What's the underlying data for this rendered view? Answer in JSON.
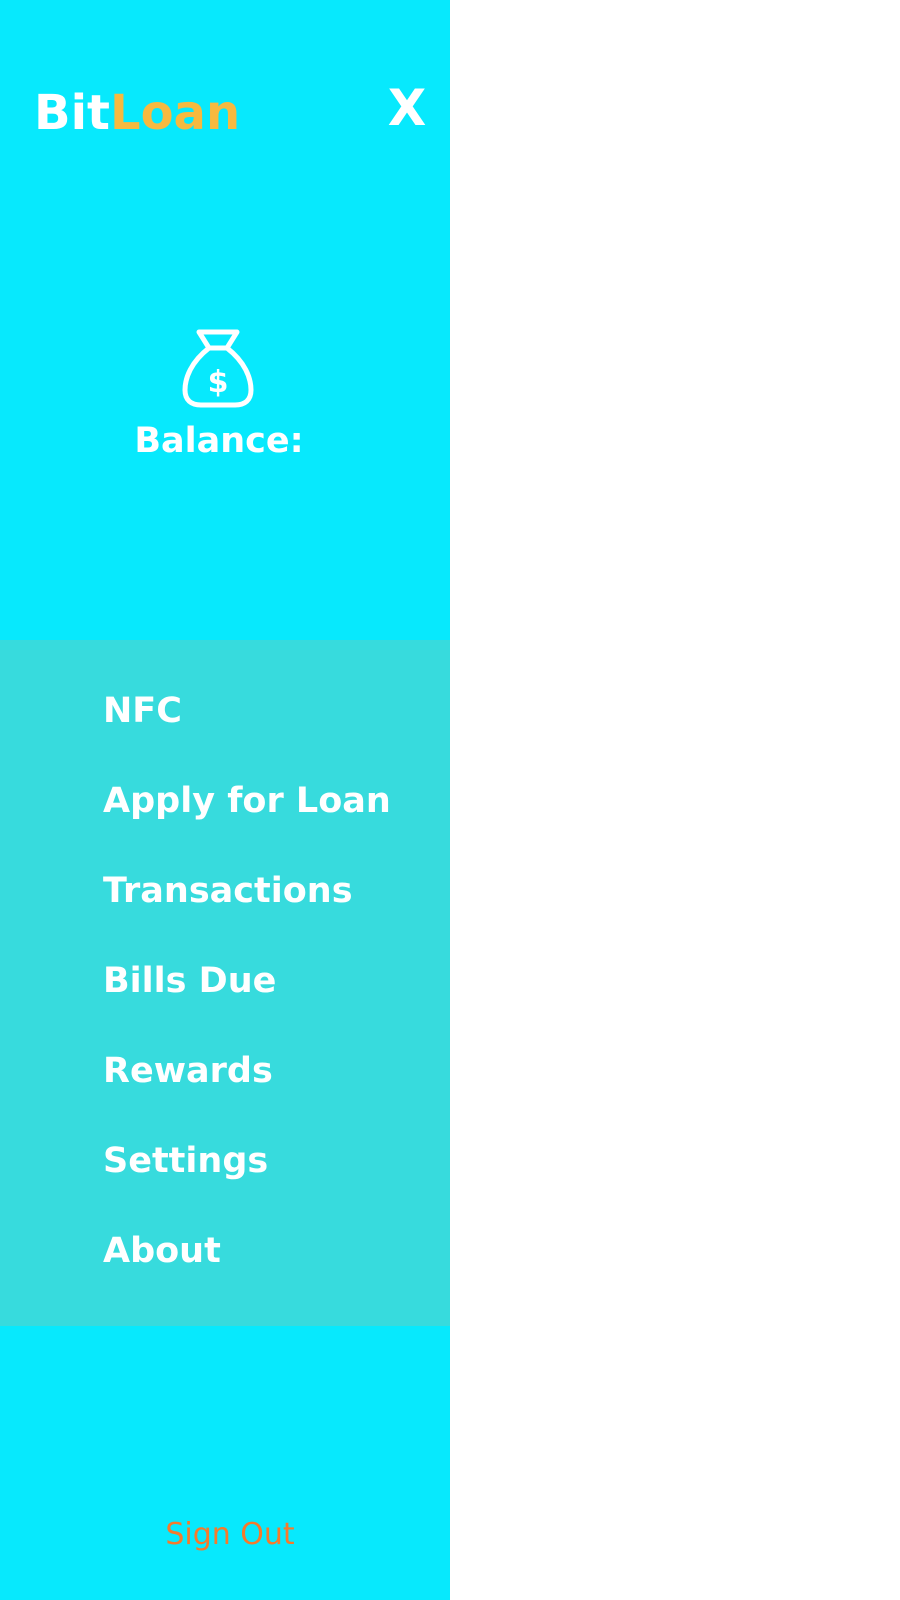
{
  "brand": {
    "part1": "Bit",
    "part2": "Loan",
    "color_part1": "#ffffff",
    "color_part2": "#f7b93f"
  },
  "close_label": "X",
  "balance": {
    "icon": "money-bag-icon",
    "label": "Balance:"
  },
  "menu": {
    "items": [
      {
        "label": "NFC"
      },
      {
        "label": "Apply for Loan"
      },
      {
        "label": "Transactions"
      },
      {
        "label": "Bills Due"
      },
      {
        "label": "Rewards"
      },
      {
        "label": "Settings"
      },
      {
        "label": "About"
      }
    ]
  },
  "signout_label": "Sign Out",
  "colors": {
    "drawer_bg": "#07e9fd",
    "menu_bg": "#37dbdd",
    "signout": "#f57a2c",
    "accent": "#f7b93f"
  }
}
